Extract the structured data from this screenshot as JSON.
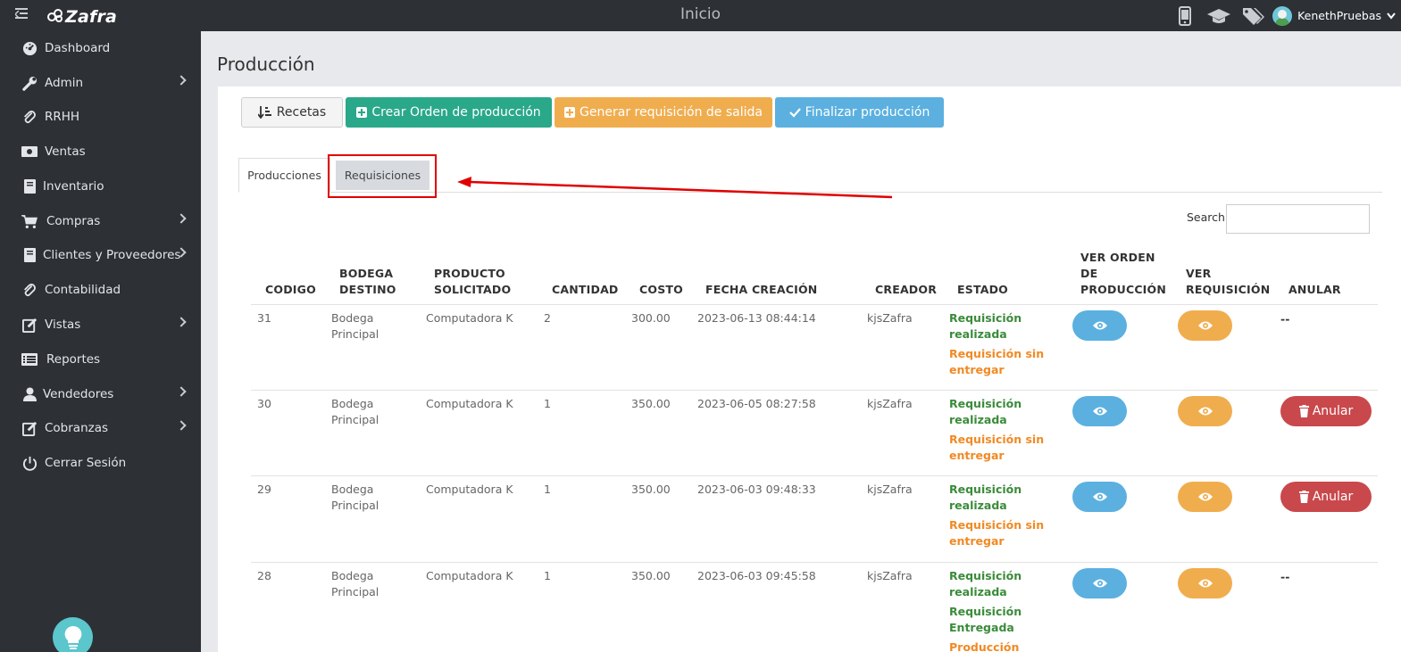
{
  "topbar": {
    "brand": "Zafra",
    "title": "Inicio",
    "user": "KenethPruebas",
    "icons": [
      "mobile-icon",
      "graduation-cap-icon",
      "tags-icon"
    ]
  },
  "sidebar": {
    "items": [
      {
        "label": "Dashboard",
        "icon": "dashboard-icon",
        "has_sub": false
      },
      {
        "label": "Admin",
        "icon": "wrench-icon",
        "has_sub": true
      },
      {
        "label": "RRHH",
        "icon": "paperclip-icon",
        "has_sub": false
      },
      {
        "label": "Ventas",
        "icon": "money-icon",
        "has_sub": false
      },
      {
        "label": "Inventario",
        "icon": "book-icon",
        "has_sub": false
      },
      {
        "label": "Compras",
        "icon": "cart-icon",
        "has_sub": true
      },
      {
        "label": "Clientes y Proveedores",
        "icon": "address-book-icon",
        "has_sub": true
      },
      {
        "label": "Contabilidad",
        "icon": "paperclip-icon",
        "has_sub": false
      },
      {
        "label": "Vistas",
        "icon": "edit-icon",
        "has_sub": true
      },
      {
        "label": "Reportes",
        "icon": "list-icon",
        "has_sub": false
      },
      {
        "label": "Vendedores",
        "icon": "user-icon",
        "has_sub": true
      },
      {
        "label": "Cobranzas",
        "icon": "edit-icon",
        "has_sub": true
      },
      {
        "label": "Cerrar Sesión",
        "icon": "power-icon",
        "has_sub": false
      }
    ]
  },
  "page": {
    "title": "Producción"
  },
  "toolbar": {
    "recetas": "Recetas",
    "crear": "Crear Orden de producción",
    "generar": "Generar requisición de salida",
    "finalizar": "Finalizar producción"
  },
  "tabs": {
    "producciones": "Producciones",
    "requisiciones": "Requisiciones"
  },
  "search": {
    "label": "Search:",
    "value": ""
  },
  "table": {
    "headers": {
      "codigo": "CODIGO",
      "bodega_1": "BODEGA",
      "bodega_2": "DESTINO",
      "producto_1": "PRODUCTO",
      "producto_2": "SOLICITADO",
      "cantidad": "CANTIDAD",
      "costo": "COSTO",
      "fecha": "FECHA CREACIÓN",
      "creador": "CREADOR",
      "estado": "ESTADO",
      "ver_orden_1": "VER ORDEN",
      "ver_orden_2": "DE",
      "ver_orden_3": "PRODUCCIÓN",
      "ver_req_1": "VER",
      "ver_req_2": "REQUISICIÓN",
      "anular": "ANULAR"
    },
    "rows": [
      {
        "codigo": "31",
        "bodega_1": "Bodega",
        "bodega_2": "Principal",
        "producto": "Computadora K",
        "cantidad": "2",
        "costo": "300.00",
        "fecha": "2023-06-13 08:44:14",
        "creador": "kjsZafra",
        "estado": [
          {
            "l1": "Requisición",
            "l2": "realizada",
            "color": "green"
          },
          {
            "l1": "Requisición sin",
            "l2": "entregar",
            "color": "orange"
          }
        ],
        "anular": "--"
      },
      {
        "codigo": "30",
        "bodega_1": "Bodega",
        "bodega_2": "Principal",
        "producto": "Computadora K",
        "cantidad": "1",
        "costo": "350.00",
        "fecha": "2023-06-05 08:27:58",
        "creador": "kjsZafra",
        "estado": [
          {
            "l1": "Requisición",
            "l2": "realizada",
            "color": "green"
          },
          {
            "l1": "Requisición sin",
            "l2": "entregar",
            "color": "orange"
          }
        ],
        "anular": "Anular"
      },
      {
        "codigo": "29",
        "bodega_1": "Bodega",
        "bodega_2": "Principal",
        "producto": "Computadora K",
        "cantidad": "1",
        "costo": "350.00",
        "fecha": "2023-06-03 09:48:33",
        "creador": "kjsZafra",
        "estado": [
          {
            "l1": "Requisición",
            "l2": "realizada",
            "color": "green"
          },
          {
            "l1": "Requisición sin",
            "l2": "entregar",
            "color": "orange"
          }
        ],
        "anular": "Anular"
      },
      {
        "codigo": "28",
        "bodega_1": "Bodega",
        "bodega_2": "Principal",
        "producto": "Computadora K",
        "cantidad": "1",
        "costo": "350.00",
        "fecha": "2023-06-03 09:45:58",
        "creador": "kjsZafra",
        "estado": [
          {
            "l1": "Requisición",
            "l2": "realizada",
            "color": "green"
          },
          {
            "l1": "Requisición",
            "l2": "Entregada",
            "color": "green"
          },
          {
            "l1": "Producción",
            "l2": "",
            "color": "orange"
          }
        ],
        "anular": "--"
      }
    ]
  },
  "colors": {
    "sidebar_bg": "#2d3035",
    "content_bg": "#e7e9ec",
    "green_btn": "#2aa88a",
    "orange_btn": "#f0ad4e",
    "blue_btn": "#5bb0e0",
    "red_btn": "#c9484c",
    "annotation_red": "#e10000"
  }
}
